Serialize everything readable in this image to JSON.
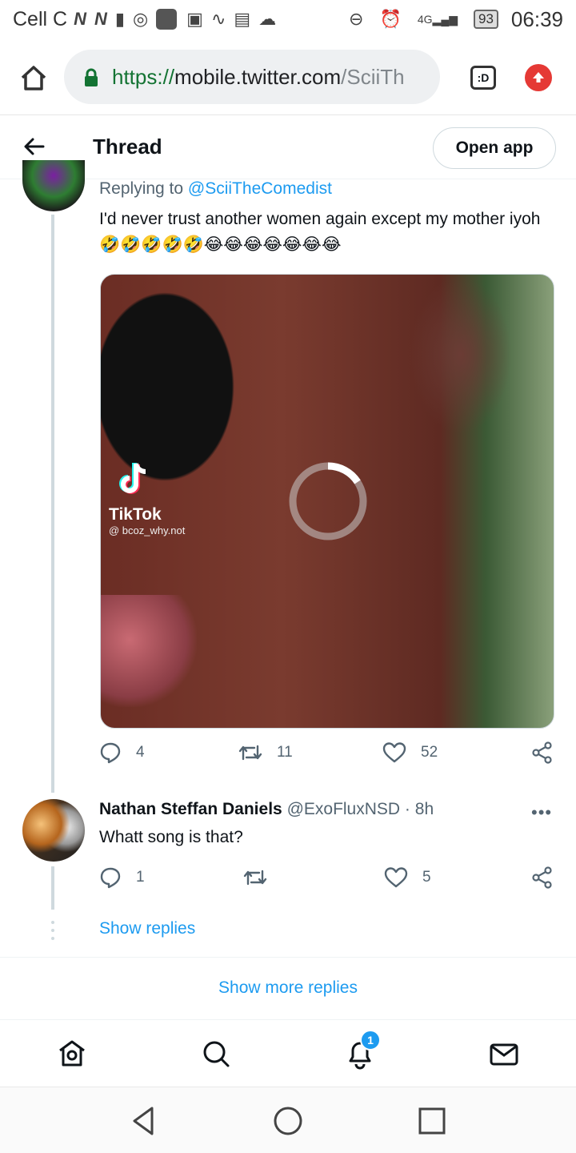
{
  "status_bar": {
    "carrier": "Cell C",
    "battery": "93",
    "time": "06:39",
    "network": "4G"
  },
  "browser": {
    "url_scheme": "https://",
    "url_host": "mobile.twitter.com",
    "url_path": "/SciiTh",
    "tab_label": ":D"
  },
  "header": {
    "title": "Thread",
    "open_app_label": "Open app"
  },
  "tweet1": {
    "replying_prefix": "Replying to ",
    "replying_handle": "@SciiTheComedist",
    "text": "I'd never trust another women again except my mother iyoh 🤣🤣🤣🤣🤣😂😂😂😂😂😂😂",
    "media": {
      "watermark_name": "TikTok",
      "watermark_handle": "@ bcoz_why.not"
    },
    "replies": "4",
    "retweets": "11",
    "likes": "52"
  },
  "tweet2": {
    "author_name": "Nathan Steffan Daniels",
    "author_handle": "@ExoFluxNSD",
    "separator": "·",
    "time": "8h",
    "more": "•••",
    "text": "Whatt song is that?",
    "replies": "1",
    "retweets": "",
    "likes": "5",
    "show_replies": "Show replies"
  },
  "show_more_replies": "Show more replies",
  "bottom_nav": {
    "notification_badge": "1"
  },
  "colors": {
    "link": "#1d9bf0",
    "secure": "#137333",
    "update": "#e53935"
  }
}
